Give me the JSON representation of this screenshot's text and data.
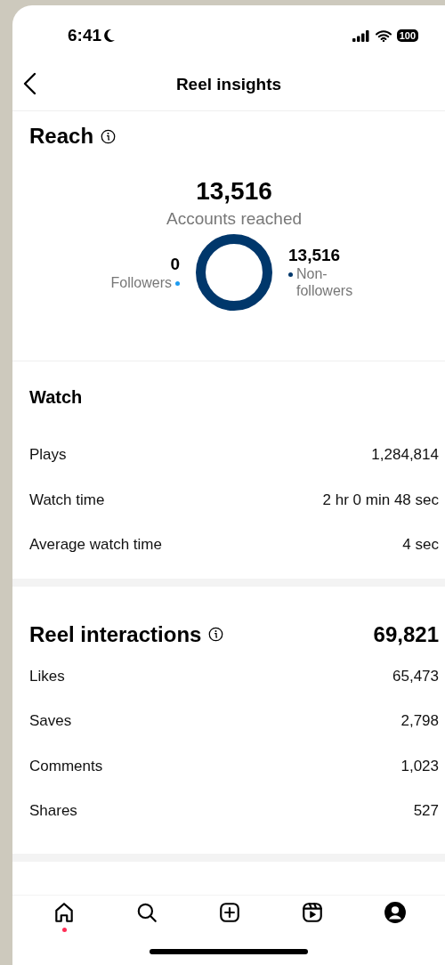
{
  "status_bar": {
    "time": "6:41",
    "battery": "100"
  },
  "header": {
    "title": "Reel insights"
  },
  "reach": {
    "title": "Reach",
    "total": "13,516",
    "total_label": "Accounts reached",
    "legend": [
      {
        "value": "0",
        "label": "Followers",
        "color": "#1d9bf0"
      },
      {
        "value": "13,516",
        "label": "Non-followers",
        "color": "#00376b"
      }
    ]
  },
  "watch": {
    "title": "Watch",
    "rows": [
      {
        "label": "Plays",
        "value": "1,284,814"
      },
      {
        "label": "Watch time",
        "value": "2 hr 0 min 48 sec"
      },
      {
        "label": "Average watch time",
        "value": "4 sec"
      }
    ]
  },
  "interactions": {
    "title": "Reel interactions",
    "total": "69,821",
    "rows": [
      {
        "label": "Likes",
        "value": "65,473"
      },
      {
        "label": "Saves",
        "value": "2,798"
      },
      {
        "label": "Comments",
        "value": "1,023"
      },
      {
        "label": "Shares",
        "value": "527"
      }
    ]
  },
  "nav": [
    {
      "kind": "home",
      "notification": true
    },
    {
      "kind": "search",
      "notification": false
    },
    {
      "kind": "create",
      "notification": false
    },
    {
      "kind": "reels",
      "notification": false
    },
    {
      "kind": "profile",
      "notification": false
    }
  ]
}
